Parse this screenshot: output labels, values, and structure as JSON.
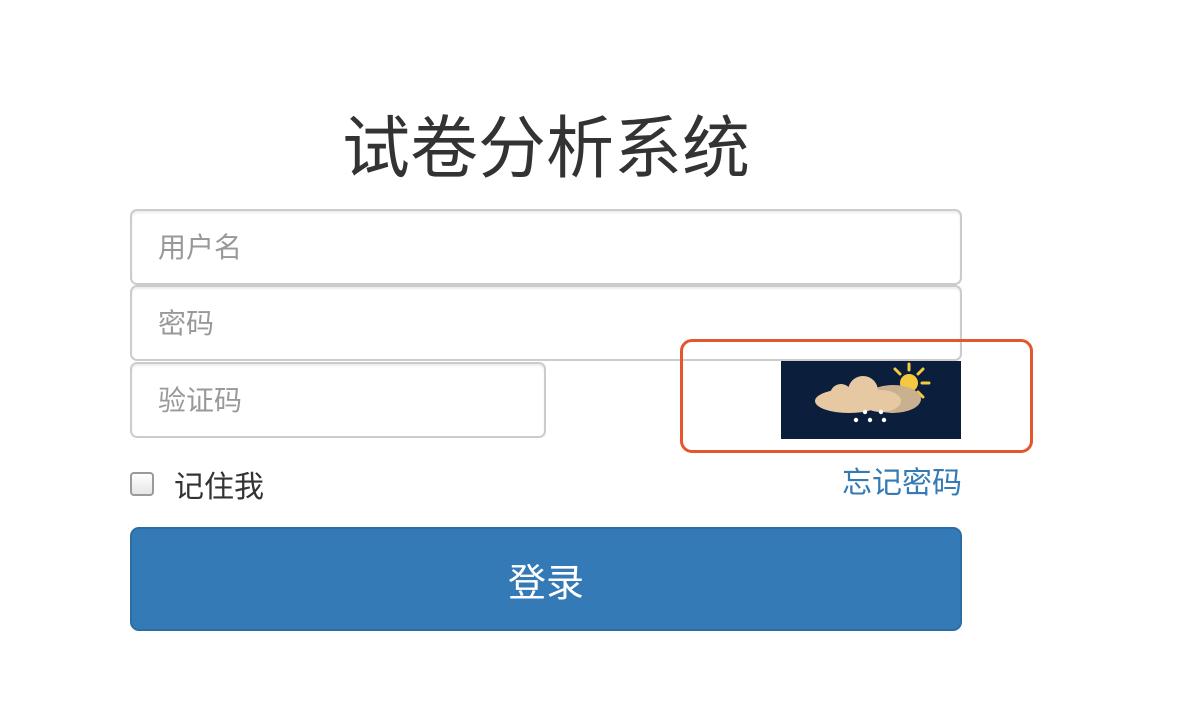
{
  "app": {
    "title": "试卷分析系统"
  },
  "form": {
    "username_placeholder": "用户名",
    "username_value": "",
    "password_placeholder": "密码",
    "password_value": "",
    "captcha_placeholder": "验证码",
    "captcha_value": "",
    "captcha_image_icon": "rain-cloud-sun-icon",
    "remember_label": "记住我",
    "remember_checked": false,
    "forgot_label": "忘记密码",
    "login_label": "登录"
  },
  "colors": {
    "primary": "#337ab7",
    "highlight": "#e4572e",
    "captcha_bg": "#0b1f3c"
  }
}
